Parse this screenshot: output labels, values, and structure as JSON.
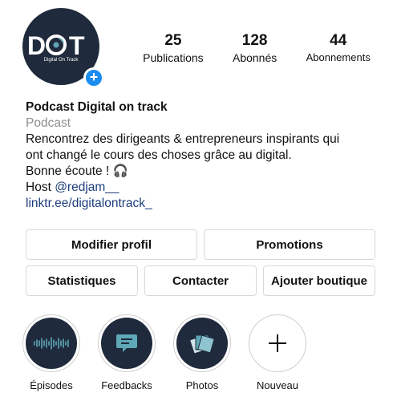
{
  "profile": {
    "logo_text": "DOT",
    "logo_sub": "Digital On Track",
    "add_badge": "+"
  },
  "stats": [
    {
      "value": "25",
      "label": "Publications"
    },
    {
      "value": "128",
      "label": "Abonnés"
    },
    {
      "value": "44",
      "label": "Abonnements"
    }
  ],
  "bio": {
    "name": "Podcast Digital on track",
    "category": "Podcast",
    "line1": "Rencontrez des dirigeants & entrepreneurs inspirants qui",
    "line2": "ont changé le cours des choses grâce au digital.",
    "line3": "Bonne écoute ! 🎧",
    "host_prefix": "Host ",
    "host_handle": "@redjam__",
    "link": "linktr.ee/digitalontrack_"
  },
  "buttons": {
    "edit_profile": "Modifier profil",
    "promotions": "Promotions",
    "statistics": "Statistiques",
    "contact": "Contacter",
    "add_shop": "Ajouter boutique"
  },
  "highlights": [
    {
      "label": "Épisodes",
      "icon": "soundwave-icon"
    },
    {
      "label": "Feedbacks",
      "icon": "chat-bubble-icon"
    },
    {
      "label": "Photos",
      "icon": "photos-icon"
    },
    {
      "label": "Nouveau",
      "icon": "plus-icon"
    }
  ],
  "colors": {
    "brand_dark": "#1f2a3c",
    "accent_teal": "#5fa8b8",
    "link_blue": "#1c3d7a",
    "badge_blue": "#1a8cf0"
  }
}
